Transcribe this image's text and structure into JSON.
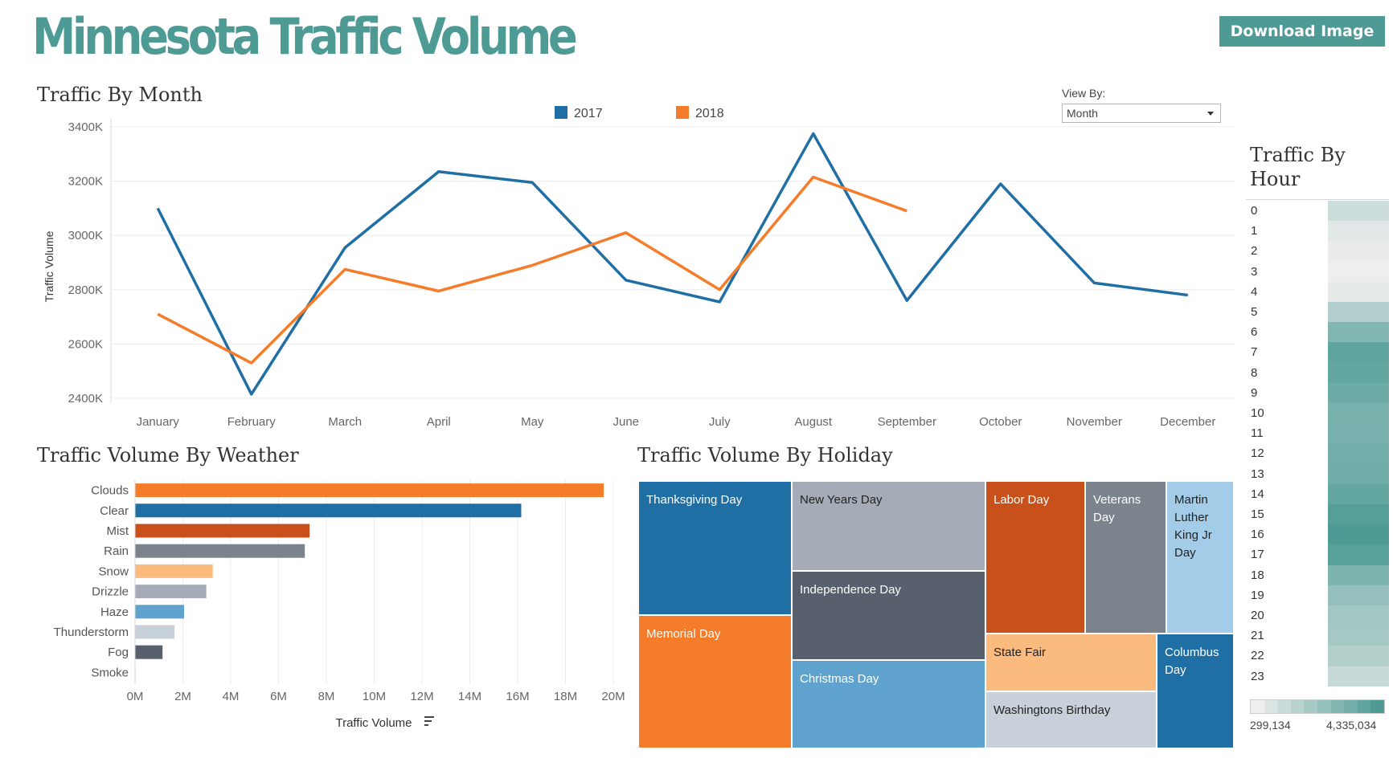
{
  "header": {
    "title": "Minnesota Traffic Volume",
    "download_label": "Download Image"
  },
  "view_by": {
    "label": "View By:",
    "value": "Month"
  },
  "colors": {
    "2017": "#1f6fa5",
    "2018": "#f47c2a",
    "accent": "#4e9b95"
  },
  "chart_data": [
    {
      "type": "line",
      "title": "Traffic By Month",
      "ylabel": "Traffic Volume",
      "categories": [
        "January",
        "February",
        "March",
        "April",
        "May",
        "June",
        "July",
        "August",
        "September",
        "October",
        "November",
        "December"
      ],
      "yticks": [
        "2400K",
        "2600K",
        "2800K",
        "3000K",
        "3200K",
        "3400K"
      ],
      "ylim": [
        2400000,
        3400000
      ],
      "legend_position": "top",
      "series": [
        {
          "name": "2017",
          "values": [
            3100000,
            2415000,
            2955000,
            3235000,
            3195000,
            2835000,
            2755000,
            3375000,
            2760000,
            3190000,
            2825000,
            2780000
          ]
        },
        {
          "name": "2018",
          "values": [
            2710000,
            2530000,
            2875000,
            2795000,
            2890000,
            3010000,
            2800000,
            3215000,
            3090000
          ]
        }
      ]
    },
    {
      "type": "bar",
      "orientation": "horizontal",
      "title": "Traffic Volume By Weather",
      "xlabel": "Traffic Volume",
      "categories": [
        "Clouds",
        "Clear",
        "Mist",
        "Rain",
        "Snow",
        "Drizzle",
        "Haze",
        "Thunderstorm",
        "Fog",
        "Smoke"
      ],
      "values": [
        19600000,
        16150000,
        7300000,
        7100000,
        3250000,
        2980000,
        2050000,
        1650000,
        1150000,
        20000
      ],
      "colors": [
        "#f47c2a",
        "#1f6fa5",
        "#c8511b",
        "#7b838d",
        "#fbbb7e",
        "#a5acb8",
        "#5fa2ce",
        "#c8d0d9",
        "#57606c",
        "#cccccc"
      ],
      "xticks": [
        "0M",
        "2M",
        "4M",
        "6M",
        "8M",
        "10M",
        "12M",
        "14M",
        "16M",
        "18M",
        "20M"
      ],
      "xlim": [
        0,
        20000000
      ]
    },
    {
      "type": "treemap",
      "title": "Traffic Volume By Holiday",
      "items": [
        {
          "name": "Thanksgiving Day",
          "color": "#1f6fa5"
        },
        {
          "name": "Memorial Day",
          "color": "#f47c2a"
        },
        {
          "name": "New Years Day",
          "color": "#a5acb8"
        },
        {
          "name": "Independence Day",
          "color": "#57606c"
        },
        {
          "name": "Christmas Day",
          "color": "#5fa2ce"
        },
        {
          "name": "Labor Day",
          "color": "#c8511b"
        },
        {
          "name": "Veterans Day",
          "color": "#7b838d"
        },
        {
          "name": "Martin Luther King Jr Day",
          "color": "#a3cce9"
        },
        {
          "name": "State Fair",
          "color": "#fbbb7e"
        },
        {
          "name": "Washingtons Birthday",
          "color": "#c8d0d9"
        },
        {
          "name": "Columbus Day",
          "color": "#1f6fa5"
        }
      ]
    },
    {
      "type": "heatmap",
      "title": "Traffic By Hour",
      "categories": [
        "0",
        "1",
        "2",
        "3",
        "4",
        "5",
        "6",
        "7",
        "8",
        "9",
        "10",
        "11",
        "12",
        "13",
        "14",
        "15",
        "16",
        "17",
        "18",
        "19",
        "20",
        "21",
        "22",
        "23"
      ],
      "values": [
        1300000,
        800000,
        600000,
        500000,
        700000,
        1900000,
        3100000,
        3900000,
        3800000,
        3600000,
        3300000,
        3350000,
        3450000,
        3500000,
        3800000,
        4150000,
        4335034,
        4100000,
        3200000,
        2650000,
        2350000,
        2250000,
        1950000,
        1450000
      ],
      "color_range": [
        "#eeeeee",
        "#4e9b95"
      ],
      "legend_min": "299,134",
      "legend_max": "4,335,034"
    }
  ]
}
